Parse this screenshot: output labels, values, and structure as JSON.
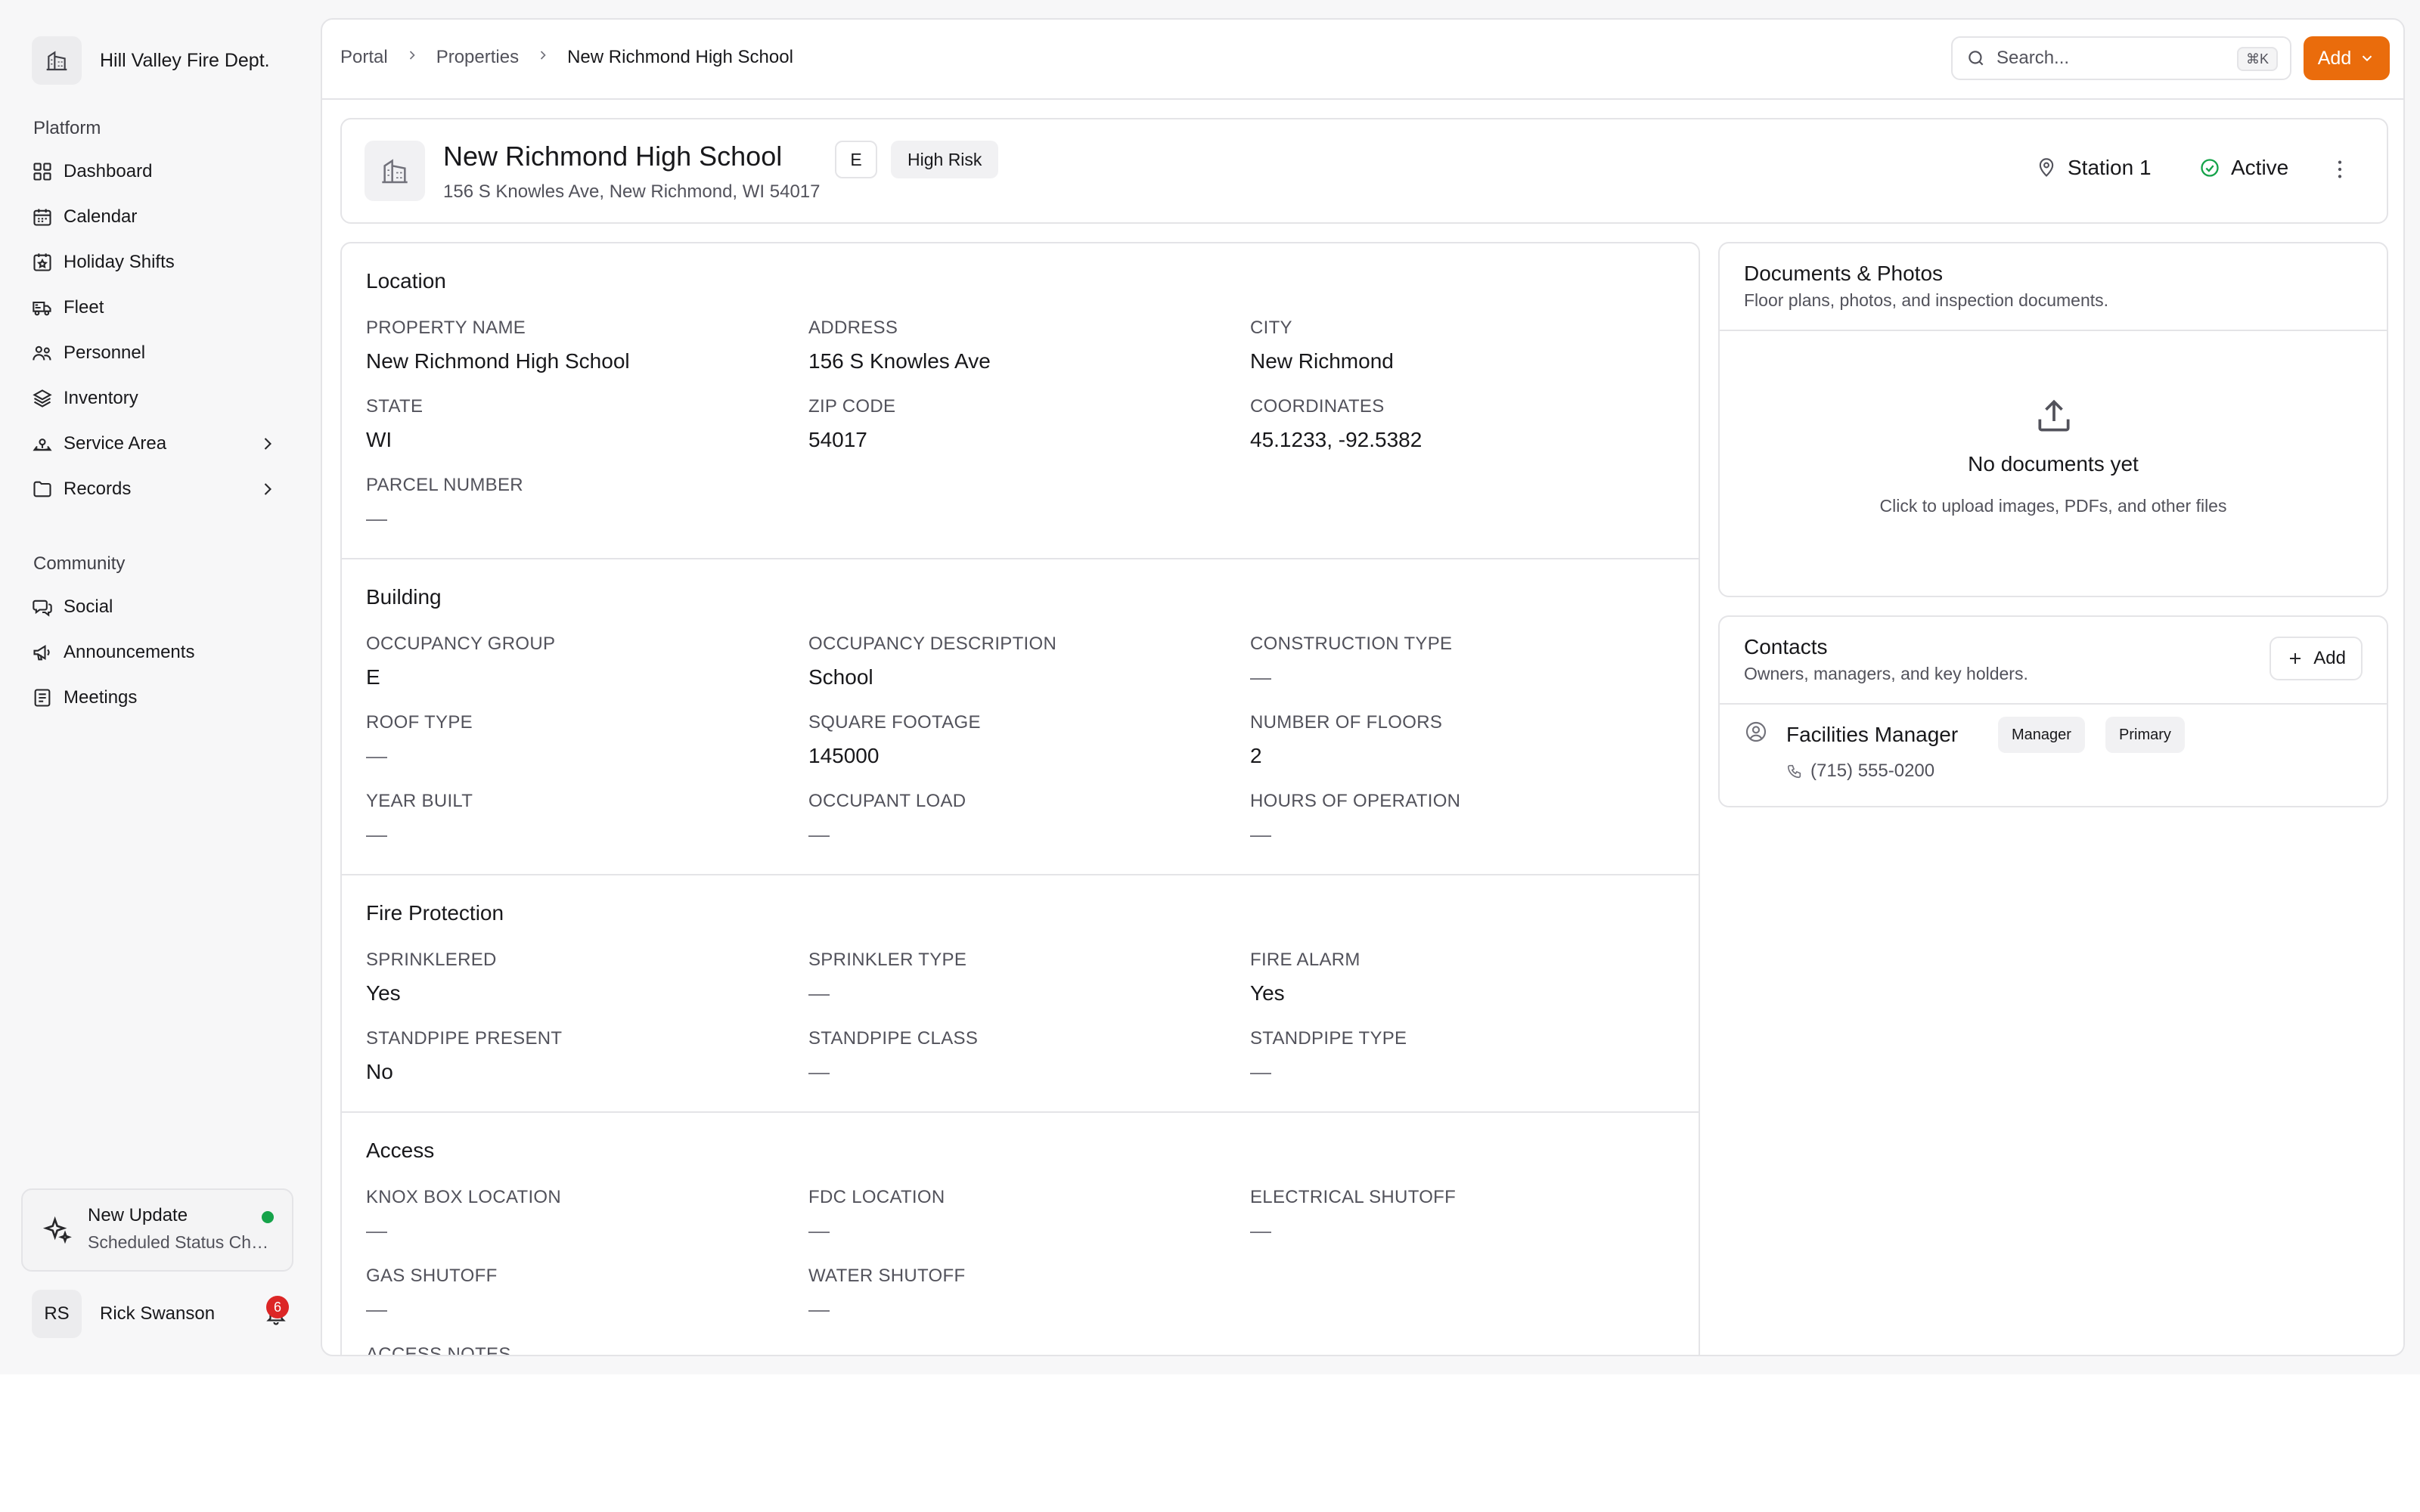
{
  "org": {
    "name": "Hill Valley Fire Dept.",
    "icon": "building-icon"
  },
  "sidebar": {
    "platform_label": "Platform",
    "platform_items": [
      {
        "label": "Dashboard",
        "icon": "dashboard-icon"
      },
      {
        "label": "Calendar",
        "icon": "calendar-icon"
      },
      {
        "label": "Holiday Shifts",
        "icon": "calendar-star-icon"
      },
      {
        "label": "Fleet",
        "icon": "truck-icon"
      },
      {
        "label": "Personnel",
        "icon": "users-icon"
      },
      {
        "label": "Inventory",
        "icon": "layers-icon"
      },
      {
        "label": "Service Area",
        "icon": "map-icon"
      },
      {
        "label": "Records",
        "icon": "folder-icon"
      }
    ],
    "community_label": "Community",
    "community_items": [
      {
        "label": "Social",
        "icon": "chat-icon"
      },
      {
        "label": "Announcements",
        "icon": "megaphone-icon"
      },
      {
        "label": "Meetings",
        "icon": "notes-icon"
      }
    ],
    "update": {
      "title": "New Update",
      "subtitle": "Scheduled Status Changes"
    },
    "user": {
      "initials": "RS",
      "name": "Rick Swanson",
      "notifications": "6"
    }
  },
  "breadcrumb": [
    "Portal",
    "Properties",
    "New Richmond High School"
  ],
  "search": {
    "placeholder": "Search...",
    "shortcut": "⌘K"
  },
  "add_button": "Add",
  "property": {
    "name": "New Richmond High School",
    "address": "156 S Knowles Ave, New Richmond, WI 54017",
    "occupancy_tag": "E",
    "risk_tag": "High Risk",
    "station": "Station 1",
    "status": "Active",
    "status_color": "#16a34a"
  },
  "sections": {
    "location": {
      "title": "Location",
      "fields": [
        {
          "label": "PROPERTY NAME",
          "value": "New Richmond High School"
        },
        {
          "label": "ADDRESS",
          "value": "156 S Knowles Ave"
        },
        {
          "label": "CITY",
          "value": "New Richmond"
        },
        {
          "label": "STATE",
          "value": "WI"
        },
        {
          "label": "ZIP CODE",
          "value": "54017"
        },
        {
          "label": "COORDINATES",
          "value": "45.1233, -92.5382"
        },
        {
          "label": "PARCEL NUMBER",
          "value": "—"
        }
      ]
    },
    "building": {
      "title": "Building",
      "fields": [
        {
          "label": "OCCUPANCY GROUP",
          "value": "E"
        },
        {
          "label": "OCCUPANCY DESCRIPTION",
          "value": "School"
        },
        {
          "label": "CONSTRUCTION TYPE",
          "value": "—"
        },
        {
          "label": "ROOF TYPE",
          "value": "—"
        },
        {
          "label": "SQUARE FOOTAGE",
          "value": "145000"
        },
        {
          "label": "NUMBER OF FLOORS",
          "value": "2"
        },
        {
          "label": "YEAR BUILT",
          "value": "—"
        },
        {
          "label": "OCCUPANT LOAD",
          "value": "—"
        },
        {
          "label": "HOURS OF OPERATION",
          "value": "—"
        }
      ]
    },
    "fire_protection": {
      "title": "Fire Protection",
      "fields": [
        {
          "label": "SPRINKLERED",
          "value": "Yes"
        },
        {
          "label": "SPRINKLER TYPE",
          "value": "—"
        },
        {
          "label": "FIRE ALARM",
          "value": "Yes"
        },
        {
          "label": "STANDPIPE PRESENT",
          "value": "No"
        },
        {
          "label": "STANDPIPE CLASS",
          "value": "—"
        },
        {
          "label": "STANDPIPE TYPE",
          "value": "—"
        }
      ]
    },
    "access": {
      "title": "Access",
      "fields": [
        {
          "label": "KNOX BOX LOCATION",
          "value": "—"
        },
        {
          "label": "FDC LOCATION",
          "value": "—"
        },
        {
          "label": "ELECTRICAL SHUTOFF",
          "value": "—"
        },
        {
          "label": "GAS SHUTOFF",
          "value": "—"
        },
        {
          "label": "WATER SHUTOFF",
          "value": "—"
        },
        {
          "label": "ACCESS NOTES",
          "value": ""
        }
      ]
    }
  },
  "documents": {
    "title": "Documents & Photos",
    "subtitle": "Floor plans, photos, and inspection documents.",
    "empty_title": "No documents yet",
    "empty_subtitle": "Click to upload images, PDFs, and other files"
  },
  "contacts": {
    "title": "Contacts",
    "subtitle": "Owners, managers, and key holders.",
    "add_label": "Add",
    "items": [
      {
        "name": "Facilities Manager",
        "role": "Manager",
        "tag": "Primary",
        "phone": "(715) 555-0200"
      }
    ]
  },
  "colors": {
    "accent": "#ea6c0c",
    "badge": "#dc2626",
    "online": "#16a34a"
  }
}
